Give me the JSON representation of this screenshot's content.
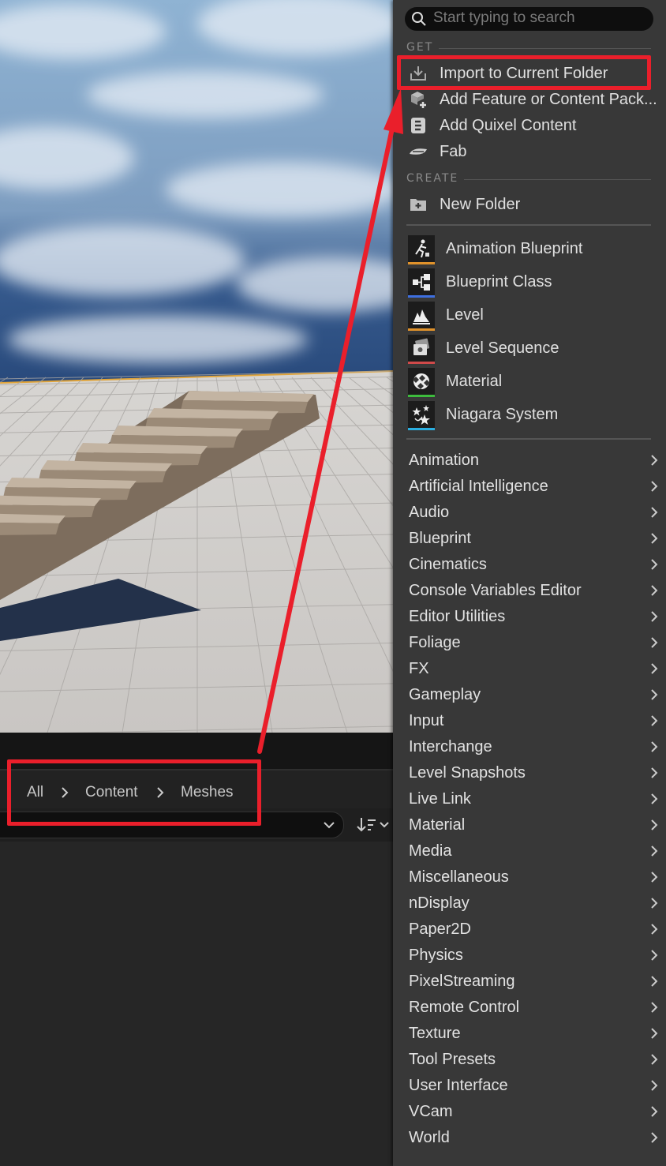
{
  "breadcrumb": [
    "All",
    "Content",
    "Meshes"
  ],
  "search": {
    "placeholder": "Start typing to search"
  },
  "menu": {
    "get_header": "GET",
    "get_items": [
      {
        "label": "Import to Current Folder",
        "icon": "import-icon"
      },
      {
        "label": "Add Feature or Content Pack...",
        "icon": "content-pack-icon"
      },
      {
        "label": "Add Quixel Content",
        "icon": "quixel-icon"
      },
      {
        "label": "Fab",
        "icon": "fab-icon"
      }
    ],
    "create_header": "CREATE",
    "new_folder": "New Folder",
    "asset_items": [
      {
        "label": "Animation Blueprint",
        "icon": "animation-blueprint-icon",
        "color": "#e0922b"
      },
      {
        "label": "Blueprint Class",
        "icon": "blueprint-class-icon",
        "color": "#3e6fe0"
      },
      {
        "label": "Level",
        "icon": "level-icon",
        "color": "#e0922b"
      },
      {
        "label": "Level Sequence",
        "icon": "level-sequence-icon",
        "color": "#d04a4a"
      },
      {
        "label": "Material",
        "icon": "material-icon",
        "color": "#3dbb3d"
      },
      {
        "label": "Niagara System",
        "icon": "niagara-system-icon",
        "color": "#2aaee0"
      }
    ],
    "categories": [
      "Animation",
      "Artificial Intelligence",
      "Audio",
      "Blueprint",
      "Cinematics",
      "Console Variables Editor",
      "Editor Utilities",
      "Foliage",
      "FX",
      "Gameplay",
      "Input",
      "Interchange",
      "Level Snapshots",
      "Live Link",
      "Material",
      "Media",
      "Miscellaneous",
      "nDisplay",
      "Paper2D",
      "Physics",
      "PixelStreaming",
      "Remote Control",
      "Texture",
      "Tool Presets",
      "User Interface",
      "VCam",
      "World"
    ]
  },
  "colors": {
    "annotation": "#ea1f2b",
    "menu_bg": "#383838",
    "text": "#e0e0e0"
  }
}
